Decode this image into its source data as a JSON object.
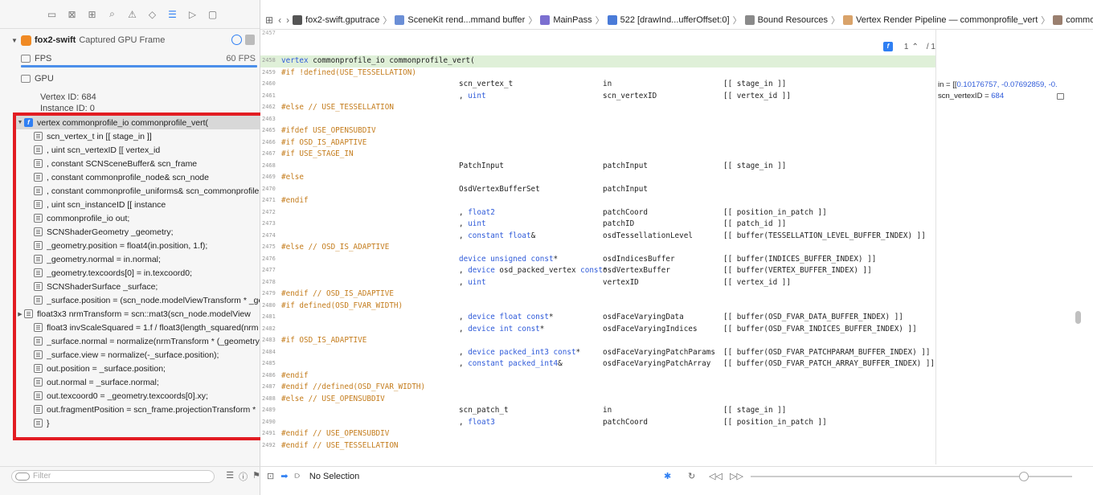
{
  "navigator": {
    "toolbar_icons": [
      "folder-icon",
      "symbol-icon",
      "hierarchy-icon",
      "search-icon",
      "warning-icon",
      "diamond-icon",
      "list-icon",
      "label-icon",
      "comment-icon"
    ],
    "frame": {
      "name": "fox2-swift",
      "subtitle": "Captured GPU Frame"
    },
    "fps": {
      "label": "FPS",
      "value": "60 FPS",
      "fill": 1.0
    },
    "gpu": {
      "label": "GPU"
    },
    "vertex_id": "Vertex ID:  684",
    "instance_id": "Instance ID:  0",
    "tree": [
      {
        "text": "vertex commonprofile_io commonprofile_vert(",
        "icon": "function",
        "disc": "▼",
        "selected": true
      },
      {
        "text": "scn_vertex_t                    in                    [[ stage_in ]]",
        "icon": "row"
      },
      {
        "text": ", uint                           scn_vertexID                [[ vertex_id",
        "icon": "row"
      },
      {
        "text": ", constant SCNSceneBuffer&        scn_frame",
        "icon": "row"
      },
      {
        "text": ", constant commonprofile_node&     scn_node",
        "icon": "row"
      },
      {
        "text": ", constant commonprofile_uniforms& scn_commonprofile",
        "icon": "row"
      },
      {
        "text": ", uint                           scn_instanceID              [[ instance",
        "icon": "row"
      },
      {
        "text": "commonprofile_io out;",
        "icon": "row"
      },
      {
        "text": "SCNShaderGeometry _geometry;",
        "icon": "row"
      },
      {
        "text": "_geometry.position = float4(in.position, 1.f);",
        "icon": "row"
      },
      {
        "text": "_geometry.normal = in.normal;",
        "icon": "row"
      },
      {
        "text": "_geometry.texcoords[0] = in.texcoord0;",
        "icon": "row"
      },
      {
        "text": "SCNShaderSurface _surface;",
        "icon": "row"
      },
      {
        "text": "_surface.position = (scn_node.modelViewTransform * _ge",
        "icon": "row"
      },
      {
        "text": "float3x3 nrmTransform = scn::mat3(scn_node.modelView",
        "icon": "row",
        "disc": "▶"
      },
      {
        "text": "float3 invScaleSquared = 1.f / float3(length_squared(nrm",
        "icon": "row"
      },
      {
        "text": "_surface.normal = normalize(nrmTransform * (_geometry.",
        "icon": "row"
      },
      {
        "text": "_surface.view = normalize(-_surface.position);",
        "icon": "row"
      },
      {
        "text": "out.position = _surface.position;",
        "icon": "row"
      },
      {
        "text": "out.normal = _surface.normal;",
        "icon": "row"
      },
      {
        "text": "out.texcoord0 = _geometry.texcoords[0].xy;",
        "icon": "row"
      },
      {
        "text": "out.fragmentPosition = scn_frame.projectionTransform *",
        "icon": "row"
      },
      {
        "text": "}",
        "icon": "row"
      }
    ],
    "filter_placeholder": "Filter"
  },
  "jumpbar": {
    "crumbs": [
      {
        "label": "fox2-swift.gputrace",
        "icon_color": "#555555"
      },
      {
        "label": "SceneKit rend...mmand buffer",
        "icon_color": "#6b8fd6"
      },
      {
        "label": "MainPass",
        "icon_color": "#7b6fd0"
      },
      {
        "label": "522 [drawInd...ufferOffset:0]",
        "icon_color": "#4a7bd8"
      },
      {
        "label": "Bound Resources",
        "icon_color": "#8a8a8a"
      },
      {
        "label": "Vertex Render Pipeline — commonprofile_vert",
        "icon_color": "#d9a36a"
      },
      {
        "label": "commonprofile_vert",
        "icon_color": "#9a7f6f"
      }
    ]
  },
  "editor": {
    "top_line_number": "2457",
    "counter": "1",
    "counter_total": "/ 1",
    "lines": [
      {
        "n": "2458",
        "hl": true,
        "c1": [
          {
            "t": "vertex ",
            "k": "kw"
          },
          {
            "t": "commonprofile_io commonprofile_vert(",
            "k": "tx"
          }
        ]
      },
      {
        "n": "2459",
        "c1": [
          {
            "t": "#if !defined(USE_TESSELLATION)",
            "k": "pp"
          }
        ]
      },
      {
        "n": "2460",
        "c2": [
          {
            "t": "scn_vertex_t",
            "k": "tx"
          }
        ],
        "c3": "in",
        "c4": "[[ stage_in ]]"
      },
      {
        "n": "2461",
        "c2": [
          {
            "t": ", ",
            "k": "tx"
          },
          {
            "t": "uint",
            "k": "kw"
          }
        ],
        "c3": "scn_vertexID",
        "c4": "[[ vertex_id ]]"
      },
      {
        "n": "2462",
        "c1": [
          {
            "t": "#else // USE_TESSELLATION",
            "k": "pp"
          }
        ]
      },
      {
        "n": "2463"
      },
      {
        "n": "2465",
        "c1": [
          {
            "t": "#ifdef USE_OPENSUBDIV",
            "k": "pp"
          }
        ]
      },
      {
        "n": "2466",
        "c1": [
          {
            "t": "#if OSD_IS_ADAPTIVE",
            "k": "pp"
          }
        ]
      },
      {
        "n": "2467",
        "c1": [
          {
            "t": "#if USE_STAGE_IN",
            "k": "pp"
          }
        ]
      },
      {
        "n": "2468",
        "c2": [
          {
            "t": "PatchInput",
            "k": "tx"
          }
        ],
        "c3": "patchInput",
        "c4": "[[ stage_in ]]"
      },
      {
        "n": "2469",
        "c1": [
          {
            "t": "#else",
            "k": "pp"
          }
        ]
      },
      {
        "n": "2470",
        "c2": [
          {
            "t": "OsdVertexBufferSet",
            "k": "tx"
          }
        ],
        "c3": "patchInput"
      },
      {
        "n": "2471",
        "c1": [
          {
            "t": "#endif",
            "k": "pp"
          }
        ]
      },
      {
        "n": "2472",
        "c2": [
          {
            "t": ", ",
            "k": "tx"
          },
          {
            "t": "float2",
            "k": "kw"
          }
        ],
        "c3": "patchCoord",
        "c4": "[[ position_in_patch ]]"
      },
      {
        "n": "2473",
        "c2": [
          {
            "t": ", ",
            "k": "tx"
          },
          {
            "t": "uint",
            "k": "kw"
          }
        ],
        "c3": "patchID",
        "c4": "[[ patch_id ]]"
      },
      {
        "n": "2474",
        "c2": [
          {
            "t": ", ",
            "k": "tx"
          },
          {
            "t": "constant float",
            "k": "kw"
          },
          {
            "t": "&",
            "k": "tx"
          }
        ],
        "c3": "osdTessellationLevel",
        "c4": "[[ buffer(TESSELLATION_LEVEL_BUFFER_INDEX) ]]"
      },
      {
        "n": "2475",
        "c1": [
          {
            "t": "#else // OSD_IS_ADAPTIVE",
            "k": "pp"
          }
        ]
      },
      {
        "n": "2476",
        "c2": [
          {
            "t": "device unsigned const",
            "k": "kw"
          },
          {
            "t": "*",
            "k": "tx"
          }
        ],
        "c3": "osdIndicesBuffer",
        "c4": "[[ buffer(INDICES_BUFFER_INDEX) ]]"
      },
      {
        "n": "2477",
        "c2": [
          {
            "t": ", ",
            "k": "tx"
          },
          {
            "t": "device ",
            "k": "kw"
          },
          {
            "t": "osd_packed_vertex ",
            "k": "tx"
          },
          {
            "t": "const",
            "k": "kw"
          },
          {
            "t": "*",
            "k": "tx"
          }
        ],
        "c3": "osdVertexBuffer",
        "c4": "[[ buffer(VERTEX_BUFFER_INDEX) ]]"
      },
      {
        "n": "2478",
        "c2": [
          {
            "t": ", ",
            "k": "tx"
          },
          {
            "t": "uint",
            "k": "kw"
          }
        ],
        "c3": "vertexID",
        "c4": "[[ vertex_id ]]"
      },
      {
        "n": "2479",
        "c1": [
          {
            "t": "#endif // OSD_IS_ADAPTIVE",
            "k": "pp"
          }
        ]
      },
      {
        "n": "2480",
        "c1": [
          {
            "t": "#if defined(OSD_FVAR_WIDTH)",
            "k": "pp"
          }
        ]
      },
      {
        "n": "2481",
        "c2": [
          {
            "t": ", ",
            "k": "tx"
          },
          {
            "t": "device float const",
            "k": "kw"
          },
          {
            "t": "*",
            "k": "tx"
          }
        ],
        "c3": "osdFaceVaryingData",
        "c4": "[[ buffer(OSD_FVAR_DATA_BUFFER_INDEX) ]]"
      },
      {
        "n": "2482",
        "c2": [
          {
            "t": ", ",
            "k": "tx"
          },
          {
            "t": "device int const",
            "k": "kw"
          },
          {
            "t": "*",
            "k": "tx"
          }
        ],
        "c3": "osdFaceVaryingIndices",
        "c4": "[[ buffer(OSD_FVAR_INDICES_BUFFER_INDEX) ]]"
      },
      {
        "n": "2483",
        "c1": [
          {
            "t": "#if OSD_IS_ADAPTIVE",
            "k": "pp"
          }
        ]
      },
      {
        "n": "2484",
        "c2": [
          {
            "t": ", ",
            "k": "tx"
          },
          {
            "t": "device packed_int3 const",
            "k": "kw"
          },
          {
            "t": "*",
            "k": "tx"
          }
        ],
        "c3": "osdFaceVaryingPatchParams",
        "c4": "[[ buffer(OSD_FVAR_PATCHPARAM_BUFFER_INDEX) ]]"
      },
      {
        "n": "2485",
        "c2": [
          {
            "t": ", ",
            "k": "tx"
          },
          {
            "t": "constant packed_int4",
            "k": "kw"
          },
          {
            "t": "&",
            "k": "tx"
          }
        ],
        "c3": "osdFaceVaryingPatchArray",
        "c4": "[[ buffer(OSD_FVAR_PATCH_ARRAY_BUFFER_INDEX) ]]"
      },
      {
        "n": "2486",
        "c1": [
          {
            "t": "#endif",
            "k": "pp"
          }
        ]
      },
      {
        "n": "2487",
        "c1": [
          {
            "t": "#endif //defined(OSD_FVAR_WIDTH)",
            "k": "pp"
          }
        ]
      },
      {
        "n": "2488",
        "c1": [
          {
            "t": "#else // USE_OPENSUBDIV",
            "k": "pp"
          }
        ]
      },
      {
        "n": "2489",
        "c2": [
          {
            "t": "scn_patch_t",
            "k": "tx"
          }
        ],
        "c3": "in",
        "c4": "[[ stage_in ]]"
      },
      {
        "n": "2490",
        "c2": [
          {
            "t": ", ",
            "k": "tx"
          },
          {
            "t": "float3",
            "k": "kw"
          }
        ],
        "c3": "patchCoord",
        "c4": "[[ position_in_patch ]]"
      },
      {
        "n": "2491",
        "c1": [
          {
            "t": "#endif // USE_OPENSUBDIV",
            "k": "pp"
          }
        ]
      },
      {
        "n": "2492",
        "c1": [
          {
            "t": "#endif // USE_TESSELLATION",
            "k": "pp"
          }
        ]
      }
    ]
  },
  "values_column": {
    "in_prefix": "in = [[",
    "in_values": "0.10176757, -0.07692859, -0.",
    "vertex_id_prefix": "scn_vertexID = ",
    "vertex_id_value": "684"
  },
  "debugbar": {
    "selection_text": "No Selection",
    "slider_position": 0.85
  },
  "colors": {
    "keyword": "#2e5ad9",
    "preprocessor": "#c47c1c",
    "highlight_line": "#dff0d8",
    "selection_box": "#e21c22",
    "accent": "#2f7ff3"
  }
}
